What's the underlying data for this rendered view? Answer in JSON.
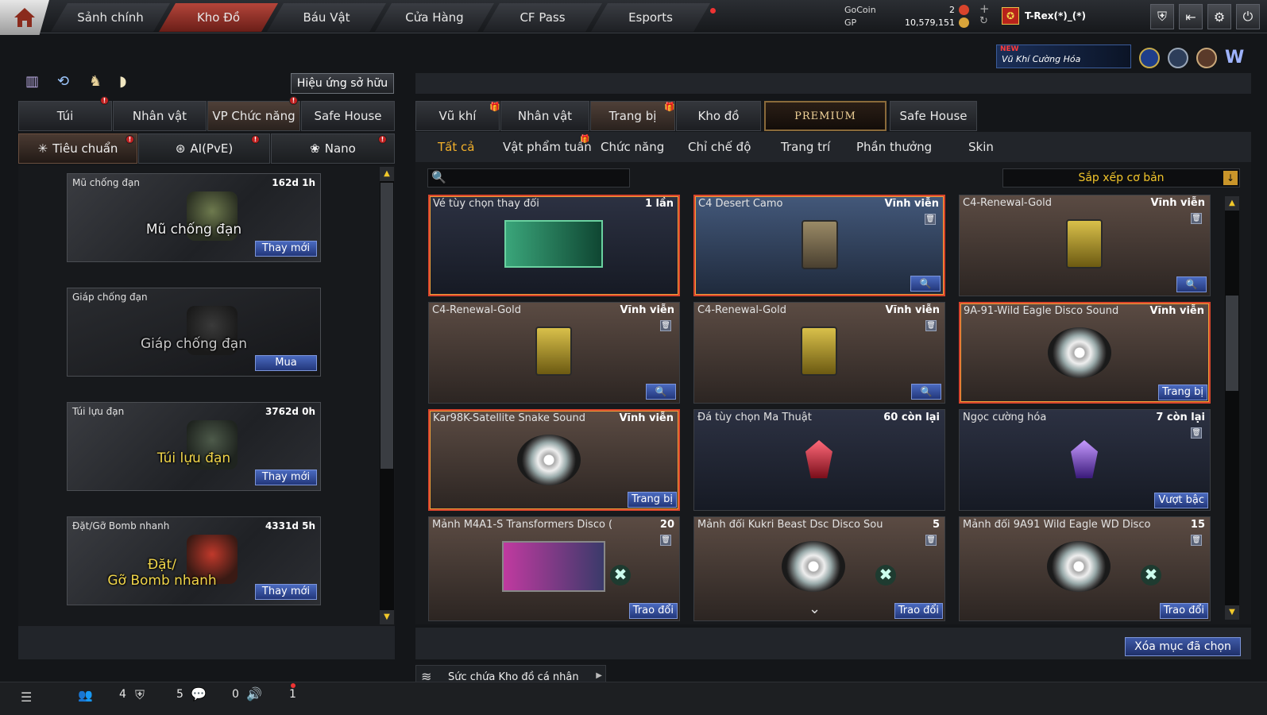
{
  "topnav": {
    "tabs": [
      "Sảnh chính",
      "Kho Đồ",
      "Báu Vật",
      "Cửa Hàng",
      "CF Pass",
      "Esports"
    ],
    "active_index": 1
  },
  "currency": {
    "gocoin_label": "GoCoin",
    "gocoin_value": "2",
    "gp_label": "GP",
    "gp_value": "10,579,151"
  },
  "user": {
    "name": "T-Rex(*)_(*)"
  },
  "promo": {
    "badge": "NEW",
    "text": "Vũ Khí Cường Hóa"
  },
  "left": {
    "effects_button": "Hiệu ứng sở hữu",
    "tabs": [
      "Túi",
      "Nhân vật",
      "VP Chức năng",
      "Safe House"
    ],
    "categories": [
      "Tiêu chuẩn",
      "AI(PvE)",
      "Nano"
    ],
    "items": [
      {
        "name": "Mũ chống đạn",
        "time": "162d 1h",
        "art_text": "Mũ chống đạn",
        "action": "Thay mới"
      },
      {
        "name": "Giáp chống đạn",
        "time": "",
        "art_text": "Giáp chống đạn",
        "action": "Mua"
      },
      {
        "name": "Túi lựu đạn",
        "time": "3762d 0h",
        "art_text": "Túi lựu đạn",
        "action": "Thay mới"
      },
      {
        "name": "Đặt/Gỡ Bomb nhanh",
        "time": "4331d 5h",
        "art_text_1": "Đặt/",
        "art_text_2": "Gỡ Bomb nhanh",
        "action": "Thay mới"
      }
    ]
  },
  "right": {
    "tabs": [
      "Vũ khí",
      "Nhân vật",
      "Trang bị",
      "Kho đồ",
      "PREMIUM",
      "Safe House"
    ],
    "filters": [
      "Tất cả",
      "Vật phẩm tuần",
      "Chức năng",
      "Chỉ chế độ",
      "Trang trí",
      "Phần thưởng",
      "Skin"
    ],
    "search_placeholder": "",
    "sort_label": "Sắp xếp cơ bản",
    "cards": [
      {
        "name": "Vé tùy chọn thay đổi",
        "value": "1 lần",
        "action": ""
      },
      {
        "name": "C4 Desert Camo",
        "value": "Vĩnh viễn",
        "action": ""
      },
      {
        "name": "C4-Renewal-Gold",
        "value": "Vĩnh viễn",
        "action": ""
      },
      {
        "name": "C4-Renewal-Gold",
        "value": "Vĩnh viễn",
        "action": ""
      },
      {
        "name": "C4-Renewal-Gold",
        "value": "Vĩnh viễn",
        "action": ""
      },
      {
        "name": "9A-91-Wild Eagle Disco Sound",
        "value": "Vĩnh viễn",
        "action": "Trang bị"
      },
      {
        "name": "Kar98K-Satellite Snake Sound",
        "value": "Vĩnh viễn",
        "action": "Trang bị"
      },
      {
        "name": "Đá tùy chọn Ma Thuật",
        "value": "60 còn lại",
        "action": ""
      },
      {
        "name": "Ngọc cường hóa",
        "value": "7 còn lại",
        "action": "Vượt bậc"
      },
      {
        "name": "Mảnh M4A1-S Transformers Disco (",
        "value": "20",
        "action": "Trao đổi"
      },
      {
        "name": "Mảnh đổi Kukri Beast Dsc Disco Sou",
        "value": "5",
        "action": "Trao đổi"
      },
      {
        "name": "Mảnh đổi 9A91 Wild Eagle WD Disco",
        "value": "15",
        "action": "Trao đổi"
      }
    ],
    "delete_button": "Xóa mục đã chọn",
    "capacity_label": "Sức chứa Kho đồ cá nhân"
  },
  "statusbar": {
    "friends_count": "4",
    "clan_count": "5",
    "chat_count": "0",
    "sound_count": "1"
  },
  "colors": {
    "accent_red": "#c0392b",
    "button_blue": "#2f4aa0",
    "selected_border": "#d8442c"
  }
}
